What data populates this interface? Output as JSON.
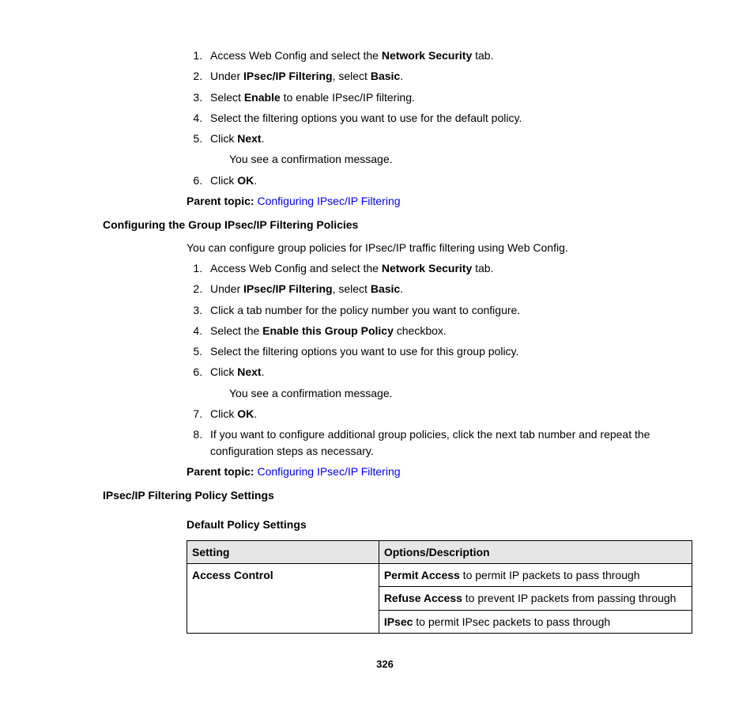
{
  "section1": {
    "steps": [
      {
        "pre": "Access Web Config and select the ",
        "bold": "Network Security",
        "post": " tab."
      },
      {
        "pre": "Under ",
        "bold": "IPsec/IP Filtering",
        "post": ", select ",
        "bold2": "Basic",
        "post2": "."
      },
      {
        "pre": "Select ",
        "bold": "Enable",
        "post": " to enable IPsec/IP filtering."
      },
      {
        "plain": "Select the filtering options you want to use for the default policy."
      },
      {
        "pre": "Click ",
        "bold": "Next",
        "post": ".",
        "after": "You see a confirmation message."
      },
      {
        "pre": "Click ",
        "bold": "OK",
        "post": "."
      }
    ],
    "parent_label": "Parent topic:",
    "parent_link": "Configuring IPsec/IP Filtering"
  },
  "section2": {
    "heading": "Configuring the Group IPsec/IP Filtering Policies",
    "intro": "You can configure group policies for IPsec/IP traffic filtering using Web Config.",
    "steps": [
      {
        "pre": "Access Web Config and select the ",
        "bold": "Network Security",
        "post": " tab."
      },
      {
        "pre": "Under ",
        "bold": "IPsec/IP Filtering",
        "post": ", select ",
        "bold2": "Basic",
        "post2": "."
      },
      {
        "plain": "Click a tab number for the policy number you want to configure."
      },
      {
        "pre": "Select the ",
        "bold": "Enable this Group Policy",
        "post": " checkbox."
      },
      {
        "plain": "Select the filtering options you want to use for this group policy."
      },
      {
        "pre": "Click ",
        "bold": "Next",
        "post": ".",
        "after": "You see a confirmation message."
      },
      {
        "pre": "Click ",
        "bold": "OK",
        "post": "."
      },
      {
        "plain": "If you want to configure additional group policies, click the next tab number and repeat the configuration steps as necessary."
      }
    ],
    "parent_label": "Parent topic:",
    "parent_link": "Configuring IPsec/IP Filtering"
  },
  "section3": {
    "heading": "IPsec/IP Filtering Policy Settings",
    "subheading": "Default Policy Settings",
    "table": {
      "headers": [
        "Setting",
        "Options/Description"
      ],
      "rows": [
        {
          "setting": "Access Control",
          "options": [
            {
              "bold": "Permit Access",
              "rest": " to permit IP packets to pass through"
            },
            {
              "bold": "Refuse Access",
              "rest": " to prevent IP packets from passing through"
            },
            {
              "bold": "IPsec",
              "rest": " to permit IPsec packets to pass through"
            }
          ]
        }
      ]
    }
  },
  "page_number": "326"
}
